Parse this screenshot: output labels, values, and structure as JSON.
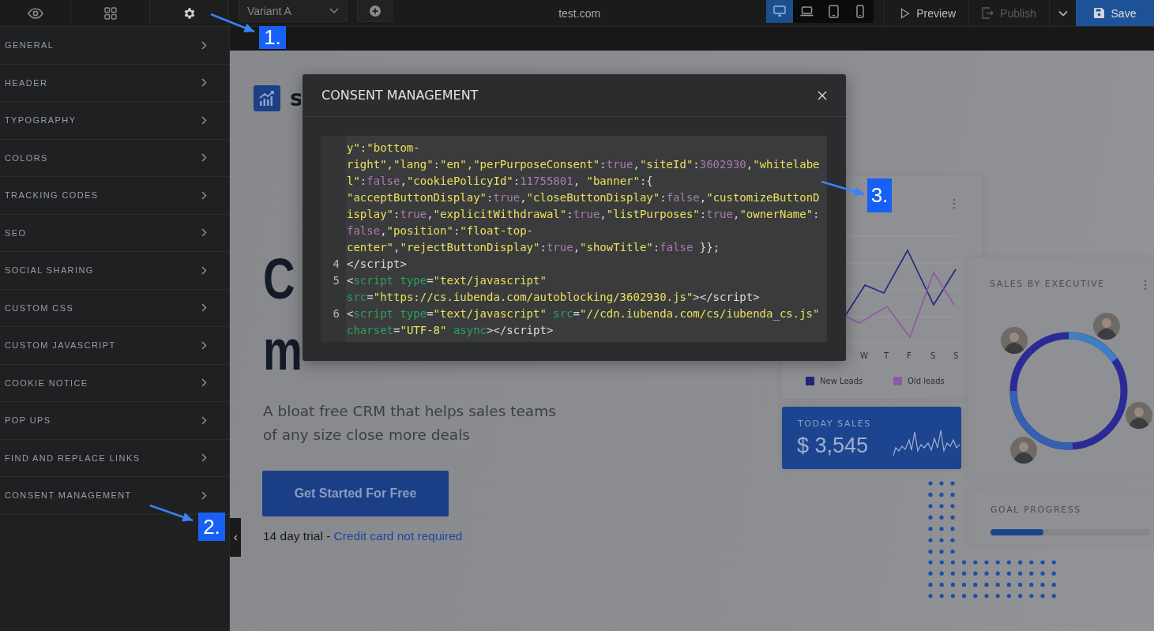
{
  "toolbar": {
    "view_tabs": [
      {
        "kind": "preview",
        "selected": false
      },
      {
        "kind": "layout",
        "selected": false
      },
      {
        "kind": "settings",
        "selected": true
      }
    ],
    "variant_select": {
      "value": "Variant A"
    },
    "domain": "test.com",
    "devices": [
      {
        "kind": "desktop",
        "selected": true
      },
      {
        "kind": "laptop",
        "selected": false
      },
      {
        "kind": "tablet",
        "selected": false
      },
      {
        "kind": "phone",
        "selected": false
      }
    ],
    "preview_button": {
      "label": "Preview",
      "disabled": false
    },
    "publish_button": {
      "label": "Publish",
      "disabled": true
    },
    "save_button": {
      "label": "Save"
    }
  },
  "sidebar": {
    "items": [
      {
        "label": "GENERAL"
      },
      {
        "label": "HEADER"
      },
      {
        "label": "TYPOGRAPHY"
      },
      {
        "label": "COLORS"
      },
      {
        "label": "TRACKING CODES"
      },
      {
        "label": "SEO"
      },
      {
        "label": "SOCIAL SHARING"
      },
      {
        "label": "CUSTOM CSS"
      },
      {
        "label": "CUSTOM JAVASCRIPT"
      },
      {
        "label": "COOKIE NOTICE"
      },
      {
        "label": "POP UPS"
      },
      {
        "label": "FIND AND REPLACE LINKS"
      },
      {
        "label": "CONSENT MANAGEMENT"
      }
    ]
  },
  "preview": {
    "logo_text": "s",
    "headline_lines": [
      "C",
      "m"
    ],
    "subtitle": "A bloat free CRM that helps sales teams of any size close more deals",
    "cta_button": "Get Started For Free",
    "trial_note": "14 day trial - ",
    "trial_link": "Credit card not required",
    "dashboard": {
      "x_labels": [
        "W",
        "T",
        "F",
        "S",
        "S"
      ],
      "legend": [
        {
          "label": "New Leads",
          "color": "#26237e"
        },
        {
          "label": "Old leads",
          "color": "#8c5aa0"
        }
      ],
      "today_sales": {
        "title": "TODAY SALES",
        "amount": "$ 3,545"
      },
      "executives": {
        "title": "SALES BY EXECUTIVE"
      },
      "goal": {
        "title": "GOAL PROGRESS",
        "level": 0.33
      }
    }
  },
  "modal": {
    "title": "CONSENT MANAGEMENT",
    "code_rows": [
      {
        "tokens": [
          {
            "kind": "str",
            "text": "y\":\"bottom-"
          }
        ]
      },
      {
        "tokens": [
          {
            "kind": "str",
            "text": "right\",\"lang\":\"en\",\"perPurposeConsent\""
          },
          {
            "kind": "plain",
            "text": ":"
          },
          {
            "kind": "lit",
            "text": "true"
          },
          {
            "kind": "plain",
            "text": ","
          },
          {
            "kind": "str",
            "text": "\"siteId\""
          },
          {
            "kind": "plain",
            "text": ":"
          },
          {
            "kind": "lit",
            "text": "3602930"
          },
          {
            "kind": "plain",
            "text": ","
          },
          {
            "kind": "str",
            "text": "\"whitelabe"
          }
        ]
      },
      {
        "tokens": [
          {
            "kind": "str",
            "text": "l\""
          },
          {
            "kind": "plain",
            "text": ":"
          },
          {
            "kind": "lit",
            "text": "false"
          },
          {
            "kind": "plain",
            "text": ","
          },
          {
            "kind": "str",
            "text": "\"cookiePolicyId\""
          },
          {
            "kind": "plain",
            "text": ":"
          },
          {
            "kind": "lit",
            "text": "11755801"
          },
          {
            "kind": "plain",
            "text": ", "
          },
          {
            "kind": "str",
            "text": "\"banner\""
          },
          {
            "kind": "plain",
            "text": ":{"
          }
        ]
      },
      {
        "tokens": [
          {
            "kind": "str",
            "text": "\"acceptButtonDisplay\""
          },
          {
            "kind": "plain",
            "text": ":"
          },
          {
            "kind": "lit",
            "text": "true"
          },
          {
            "kind": "plain",
            "text": ","
          },
          {
            "kind": "str",
            "text": "\"closeButtonDisplay\""
          },
          {
            "kind": "plain",
            "text": ":"
          },
          {
            "kind": "lit",
            "text": "false"
          },
          {
            "kind": "plain",
            "text": ","
          },
          {
            "kind": "str",
            "text": "\"customizeButtonD"
          }
        ]
      },
      {
        "tokens": [
          {
            "kind": "str",
            "text": "isplay\""
          },
          {
            "kind": "plain",
            "text": ":"
          },
          {
            "kind": "lit",
            "text": "true"
          },
          {
            "kind": "plain",
            "text": ","
          },
          {
            "kind": "str",
            "text": "\"explicitWithdrawal\""
          },
          {
            "kind": "plain",
            "text": ":"
          },
          {
            "kind": "lit",
            "text": "true"
          },
          {
            "kind": "plain",
            "text": ","
          },
          {
            "kind": "str",
            "text": "\"listPurposes\""
          },
          {
            "kind": "plain",
            "text": ":"
          },
          {
            "kind": "lit",
            "text": "true"
          },
          {
            "kind": "plain",
            "text": ","
          },
          {
            "kind": "str",
            "text": "\"ownerName\""
          },
          {
            "kind": "plain",
            "text": ":"
          }
        ]
      },
      {
        "tokens": [
          {
            "kind": "lit",
            "text": "false"
          },
          {
            "kind": "plain",
            "text": ","
          },
          {
            "kind": "str",
            "text": "\"position\""
          },
          {
            "kind": "plain",
            "text": ":"
          },
          {
            "kind": "str",
            "text": "\"float-top-"
          }
        ]
      },
      {
        "tokens": [
          {
            "kind": "str",
            "text": "center\""
          },
          {
            "kind": "plain",
            "text": ","
          },
          {
            "kind": "str",
            "text": "\"rejectButtonDisplay\""
          },
          {
            "kind": "plain",
            "text": ":"
          },
          {
            "kind": "lit",
            "text": "true"
          },
          {
            "kind": "plain",
            "text": ","
          },
          {
            "kind": "str",
            "text": "\"showTitle\""
          },
          {
            "kind": "plain",
            "text": ":"
          },
          {
            "kind": "lit",
            "text": "false"
          },
          {
            "kind": "plain",
            "text": " }};"
          }
        ]
      },
      {
        "number": "4",
        "tokens": [
          {
            "kind": "plain",
            "text": "</script>"
          }
        ]
      },
      {
        "number": "5",
        "tokens": [
          {
            "kind": "plain",
            "text": "<"
          },
          {
            "kind": "tag",
            "text": "script type"
          },
          {
            "kind": "plain",
            "text": "="
          },
          {
            "kind": "str",
            "text": "\"text/javascript\""
          }
        ]
      },
      {
        "tokens": [
          {
            "kind": "tag",
            "text": "src"
          },
          {
            "kind": "plain",
            "text": "="
          },
          {
            "kind": "str",
            "text": "\"https://cs.iubenda.com/autoblocking/3602930.js\""
          },
          {
            "kind": "plain",
            "text": "></script>"
          }
        ]
      },
      {
        "number": "6",
        "tokens": [
          {
            "kind": "plain",
            "text": "<"
          },
          {
            "kind": "tag",
            "text": "script type"
          },
          {
            "kind": "plain",
            "text": "="
          },
          {
            "kind": "str",
            "text": "\"text/javascript\""
          },
          {
            "kind": "tag",
            "text": " src"
          },
          {
            "kind": "plain",
            "text": "="
          },
          {
            "kind": "str",
            "text": "\"//cdn.iubenda.com/cs/iubenda_cs.js\""
          }
        ]
      },
      {
        "tokens": [
          {
            "kind": "tag",
            "text": "charset"
          },
          {
            "kind": "plain",
            "text": "="
          },
          {
            "kind": "str",
            "text": "\"UTF-8\""
          },
          {
            "kind": "tag",
            "text": " async"
          },
          {
            "kind": "plain",
            "text": "></script>"
          }
        ]
      }
    ]
  },
  "annotations": [
    {
      "label": "1."
    },
    {
      "label": "2."
    },
    {
      "label": "3."
    }
  ]
}
